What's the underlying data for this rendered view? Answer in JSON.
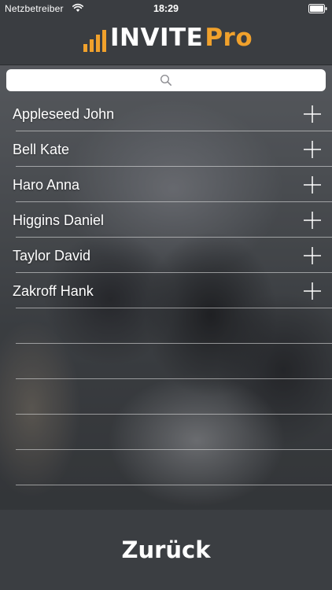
{
  "status_bar": {
    "carrier": "Netzbetreiber",
    "time": "18:29"
  },
  "logo": {
    "text_invite": "INVITE",
    "text_pro": "Pro",
    "accent_color": "#f0a12c"
  },
  "search": {
    "placeholder": "",
    "value": ""
  },
  "contacts": [
    {
      "name": "Appleseed John"
    },
    {
      "name": "Bell Kate"
    },
    {
      "name": "Haro Anna"
    },
    {
      "name": "Higgins Daniel"
    },
    {
      "name": "Taylor David"
    },
    {
      "name": "Zakroff Hank"
    }
  ],
  "empty_rows": 6,
  "footer": {
    "back_label": "Zurück"
  },
  "icons": {
    "status": [
      "wifi-icon",
      "battery-icon"
    ],
    "search": "search-icon",
    "row_action": "plus-icon"
  }
}
